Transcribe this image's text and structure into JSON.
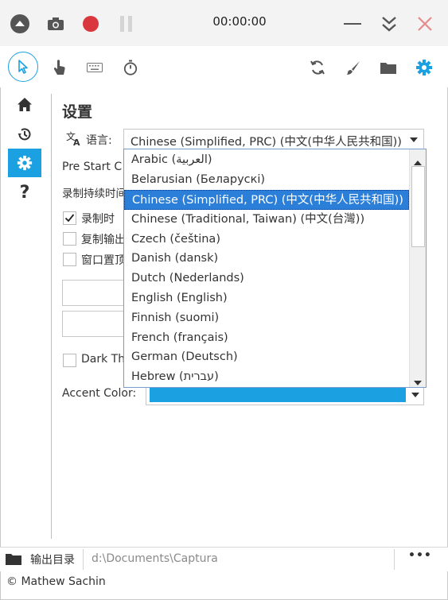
{
  "titlebar": {
    "timer": "00:00:00"
  },
  "page": {
    "title": "设置",
    "language_label": "语言:",
    "language_value": "Chinese (Simplified, PRC) (中文(中华人民共和国))",
    "pre_start_label": "Pre Start C",
    "duration_label": "录制持续时间",
    "checkbox1": "录制时",
    "checkbox2": "复制输出",
    "checkbox3": "窗口置顶",
    "dark_theme_label": "Dark Th",
    "accent_label": "Accent Color:",
    "accent_color": "#1ba1e2"
  },
  "dropdown": {
    "options": [
      "Arabic (العربية)",
      "Belarusian (Беларускі)",
      "Chinese (Simplified, PRC) (中文(中华人民共和国))",
      "Chinese (Traditional, Taiwan) (中文(台灣))",
      "Czech (čeština)",
      "Danish (dansk)",
      "Dutch (Nederlands)",
      "English (English)",
      "Finnish (suomi)",
      "French (français)",
      "German (Deutsch)",
      "Hebrew (עברית)"
    ],
    "selected_index": 2
  },
  "statusbar": {
    "output_label": "输出目录",
    "output_path": "d:\\Documents\\Captura",
    "more": "•••"
  },
  "footer": {
    "copyright": "© Mathew Sachin"
  },
  "colors": {
    "accent": "#1ba1e2",
    "record": "#d9363e",
    "close": "#e78a8a"
  }
}
